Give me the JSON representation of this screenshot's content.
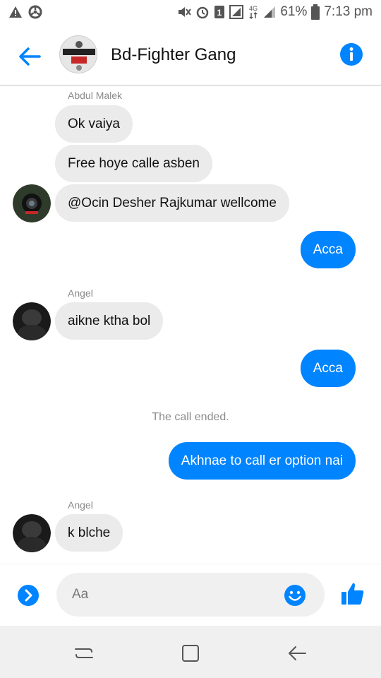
{
  "status_bar": {
    "left_icons": [
      "warning-icon",
      "settings-wheel-icon"
    ],
    "right_icons": [
      "mute-icon",
      "alarm-icon",
      "sim-1-icon",
      "data-icon",
      "4g-icon",
      "signal-icon",
      "battery-icon"
    ],
    "battery": "61%",
    "time": "7:13 pm"
  },
  "header": {
    "title": "Bd-Fighter Gang",
    "accent_color": "#0084ff"
  },
  "messages": [
    {
      "sender": "Abdul Malek"
    },
    {
      "text": "Ok vaiya",
      "direction": "in"
    },
    {
      "text": "Free hoye calle asben",
      "direction": "in"
    },
    {
      "text": "@Ocin Desher Rajkumar  wellcome",
      "direction": "in"
    },
    {
      "text": "Acca",
      "direction": "out"
    },
    {
      "sender": "Angel"
    },
    {
      "text": "aikne ktha bol",
      "direction": "in"
    },
    {
      "text": "Acca",
      "direction": "out"
    },
    {
      "system": "The call ended."
    },
    {
      "text": "Akhnae to call er option nai",
      "direction": "out"
    },
    {
      "sender": "Angel"
    },
    {
      "text": "k blche",
      "direction": "in"
    }
  ],
  "composer": {
    "placeholder": "Aa"
  },
  "colors": {
    "outgoing_bubble": "#0084ff",
    "incoming_bubble": "#ebebeb"
  }
}
